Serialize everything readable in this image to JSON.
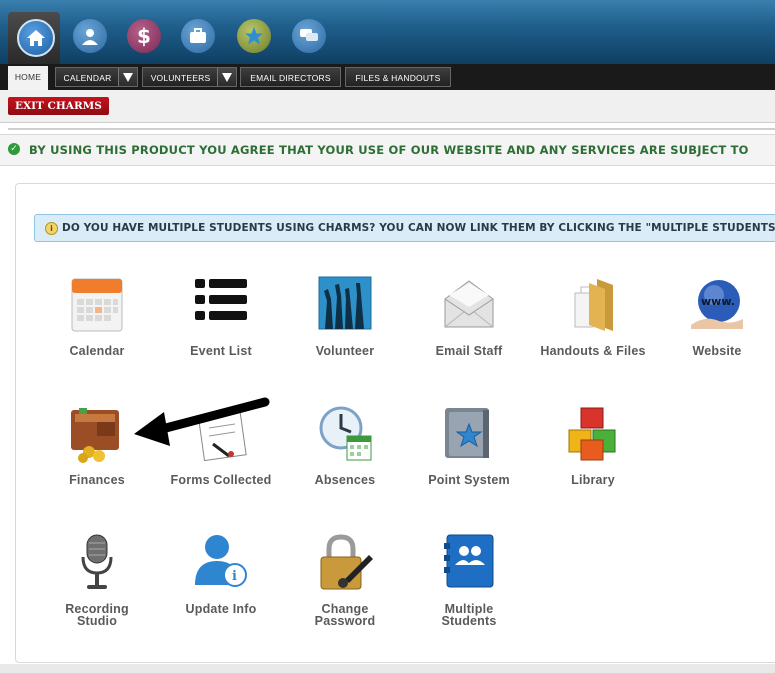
{
  "topbar": {
    "icons": [
      {
        "name": "home-icon"
      },
      {
        "name": "profile-icon"
      },
      {
        "name": "dollar-icon",
        "glyph": "$"
      },
      {
        "name": "briefcase-icon"
      },
      {
        "name": "star-icon"
      },
      {
        "name": "chat-icon"
      }
    ]
  },
  "tabs": {
    "home": "HOME",
    "calendar": "CALENDAR",
    "volunteers": "VOLUNTEERS",
    "email_directors": "EMAIL DIRECTORS",
    "files_handouts": "FILES & HANDOUTS"
  },
  "exit_label": "EXIT CHARMS",
  "agreement_text": "BY USING THIS PRODUCT YOU AGREE THAT YOUR USE OF OUR WEBSITE AND ANY SERVICES ARE SUBJECT TO",
  "info_text": "DO YOU HAVE MULTIPLE STUDENTS USING CHARMS? YOU CAN NOW LINK THEM BY CLICKING THE \"MULTIPLE STUDENTS\"",
  "tiles": [
    {
      "label": "Calendar",
      "icon": "calendar-icon"
    },
    {
      "label": "Event List",
      "icon": "list-icon"
    },
    {
      "label": "Volunteer",
      "icon": "raised-hands-icon"
    },
    {
      "label": "Email Staff",
      "icon": "envelope-icon"
    },
    {
      "label": "Handouts & Files",
      "icon": "folder-icon"
    },
    {
      "label": "Website",
      "icon": "globe-icon"
    },
    {
      "label": "Finances",
      "icon": "wallet-icon"
    },
    {
      "label": "Forms Collected",
      "icon": "form-icon"
    },
    {
      "label": "Absences",
      "icon": "clock-icon"
    },
    {
      "label": "Point System",
      "icon": "star-folder-icon"
    },
    {
      "label": "Library",
      "icon": "blocks-icon"
    },
    {
      "label": "Recording\nStudio",
      "icon": "microphone-icon"
    },
    {
      "label": "Update Info",
      "icon": "user-info-icon"
    },
    {
      "label": "Change\nPassword",
      "icon": "padlock-icon"
    },
    {
      "label": "Multiple\nStudents",
      "icon": "students-icon"
    }
  ],
  "colors": {
    "exit_red": "#b0101a",
    "agree_green": "#2d6e35",
    "info_bg": "#d9ecf7",
    "topbar_blue": "#1f5f8c"
  }
}
